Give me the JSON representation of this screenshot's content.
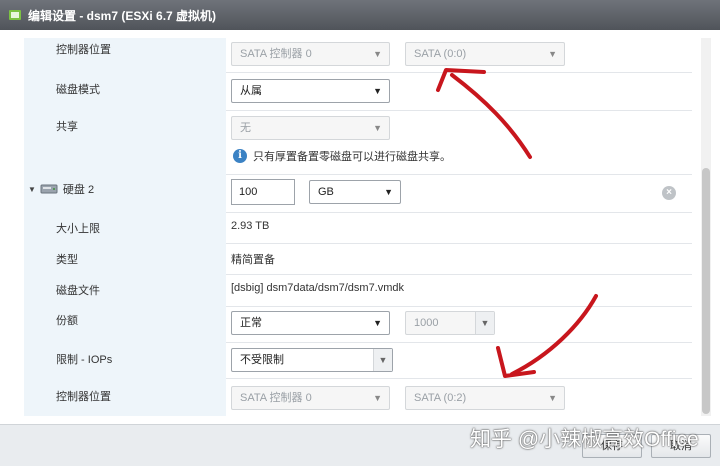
{
  "window": {
    "title": "编辑设置 - dsm7 (ESXi 6.7 虚拟机)"
  },
  "rows": {
    "controller1": {
      "label": "控制器位置",
      "controller": "SATA 控制器 0",
      "port": "SATA (0:0)"
    },
    "disk_mode": {
      "label": "磁盘模式",
      "value": "从属"
    },
    "sharing": {
      "label": "共享",
      "value": "无",
      "info": "只有厚置备置零磁盘可以进行磁盘共享。"
    },
    "disk2": {
      "label": "硬盘 2",
      "size": "100",
      "unit": "GB"
    },
    "max_size": {
      "label": "大小上限",
      "value": "2.93 TB"
    },
    "type": {
      "label": "类型",
      "value": "精简置备"
    },
    "disk_file": {
      "label": "磁盘文件",
      "value": "[dsbig] dsm7data/dsm7/dsm7.vmdk"
    },
    "shares": {
      "label": "份额",
      "value": "正常",
      "amount": "1000"
    },
    "limit_iops": {
      "label": "限制 - IOPs",
      "value": "不受限制"
    },
    "controller2": {
      "label": "控制器位置",
      "controller": "SATA 控制器 0",
      "port": "SATA (0:2)"
    }
  },
  "footer": {
    "save": "保存",
    "cancel": "取消"
  },
  "watermark": "知乎 @小辣椒高效Office",
  "annotations": {
    "arrow_color": "#c8161d"
  },
  "icons": [
    "vm-icon",
    "expand-triangle-icon",
    "hard-disk-icon",
    "info-icon",
    "remove-icon"
  ]
}
